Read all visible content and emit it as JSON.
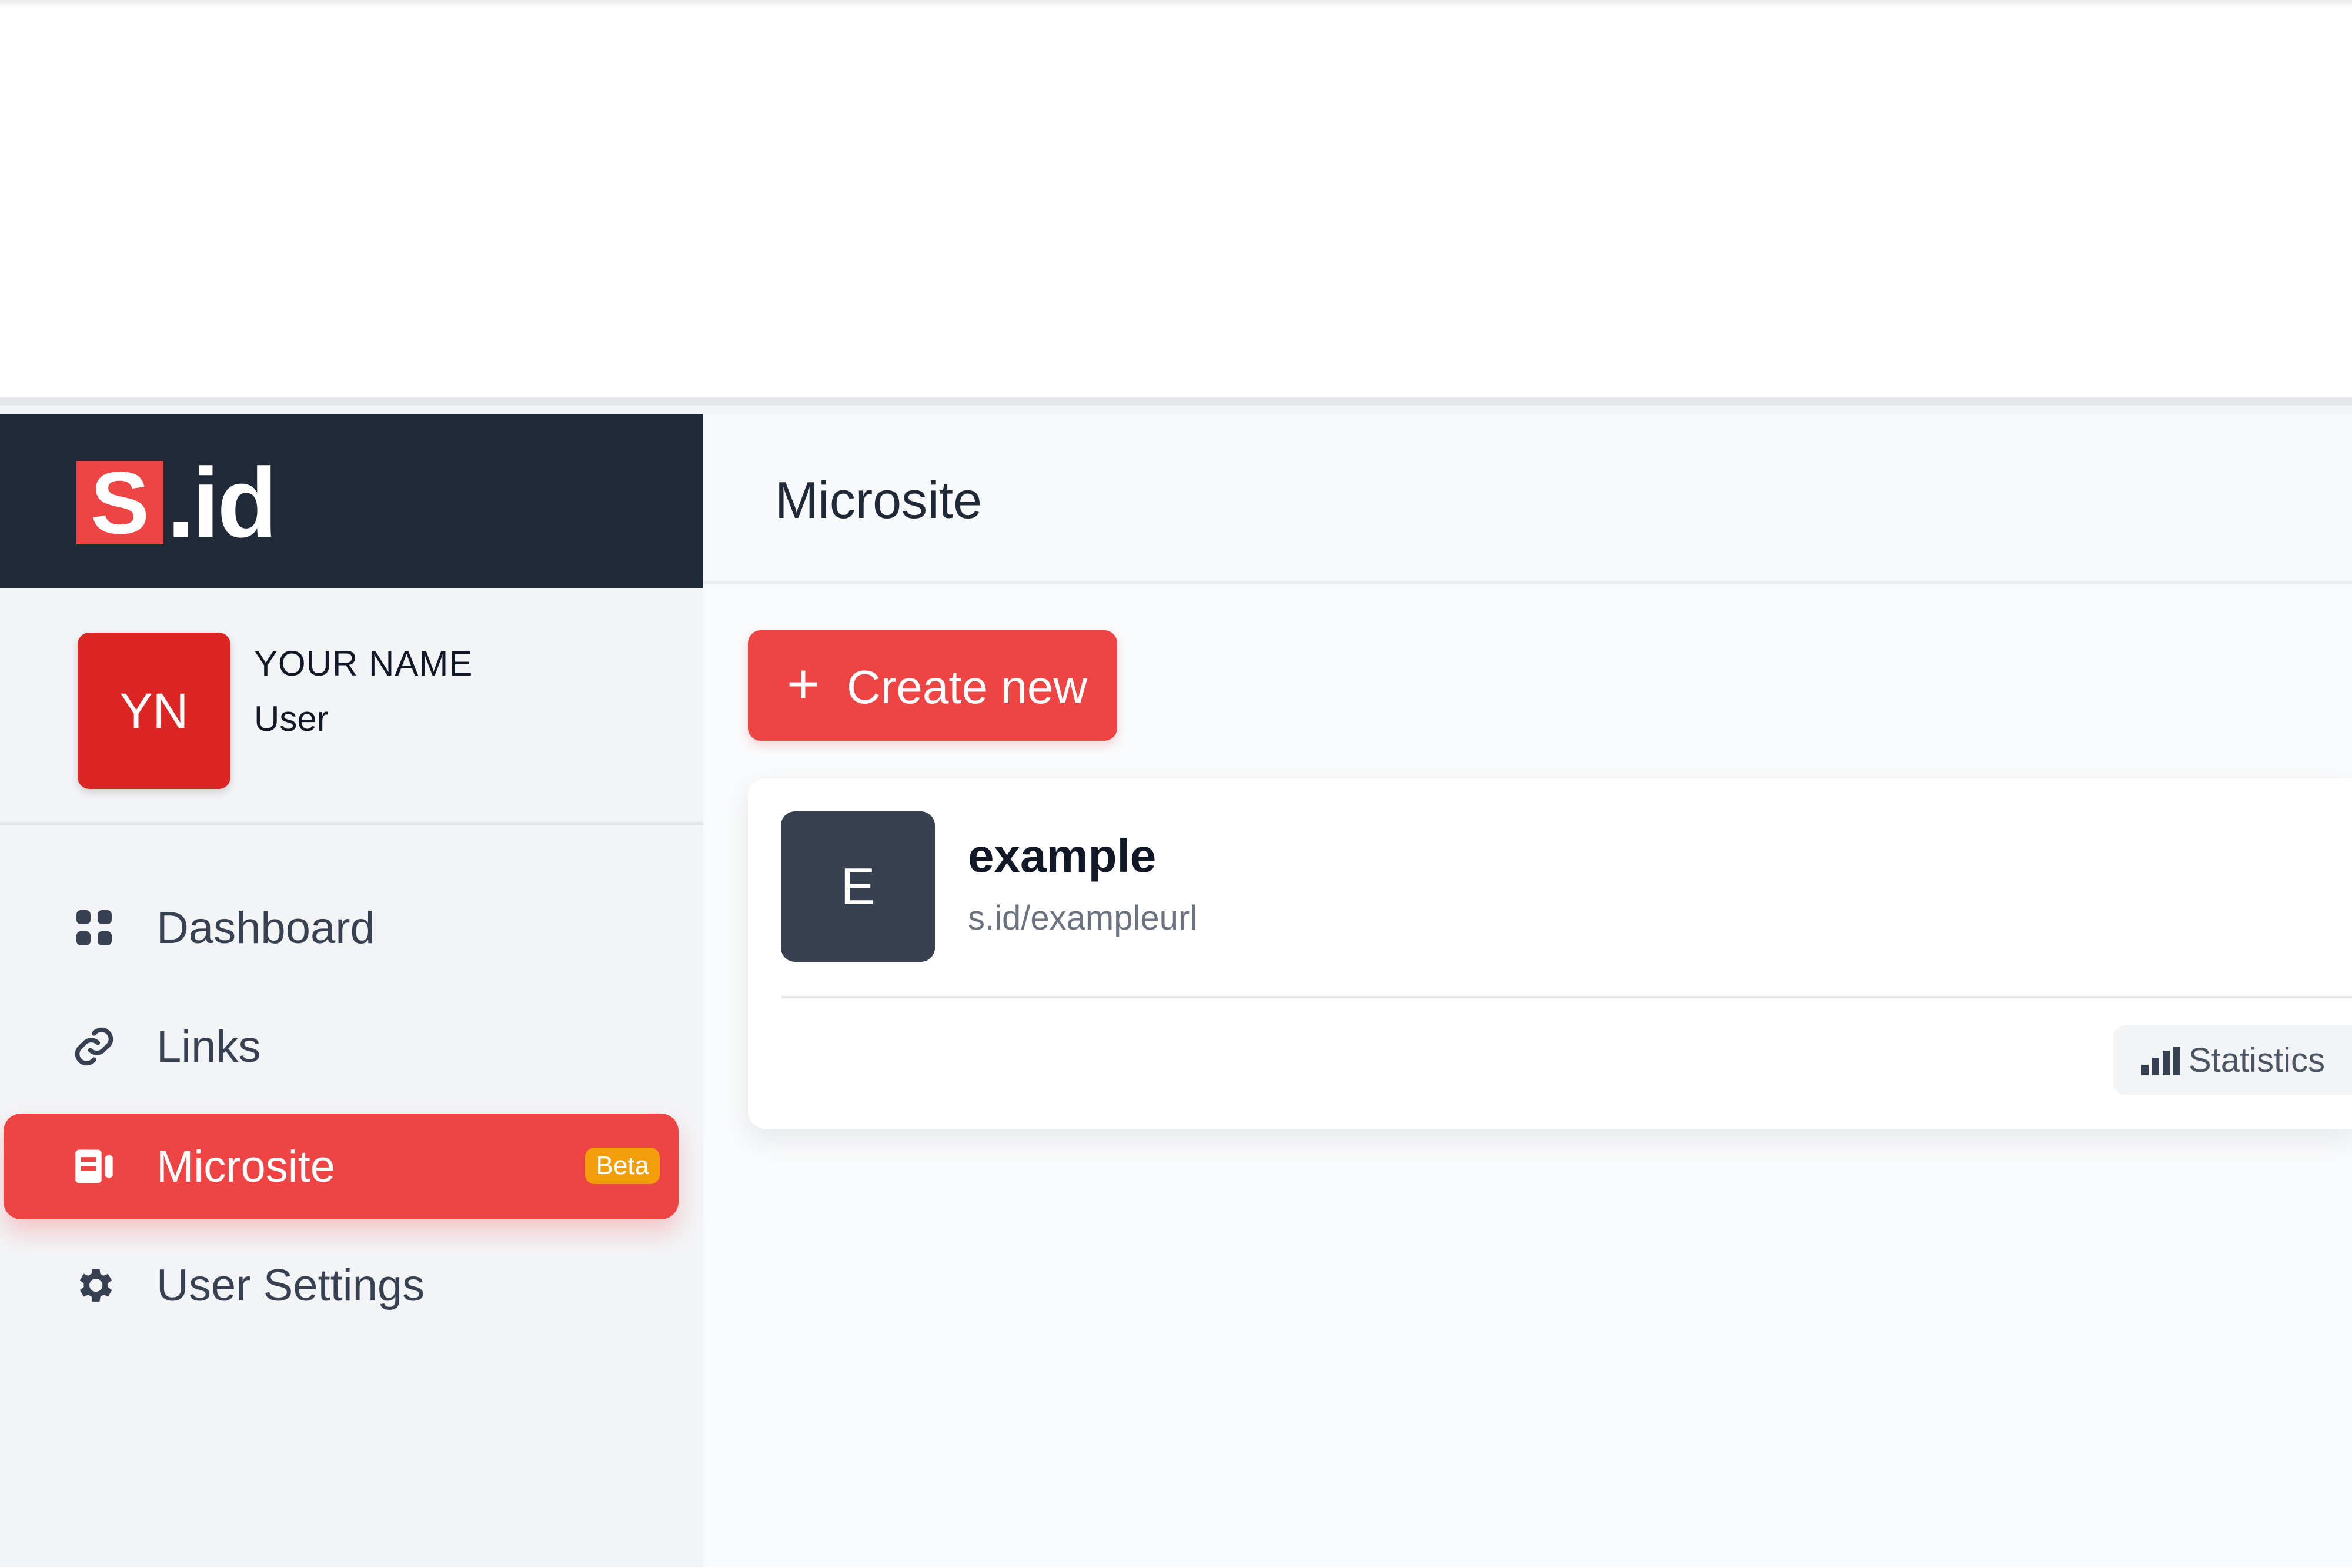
{
  "brand": {
    "logo_mark": "S",
    "logo_text": ".id",
    "logo_color": "#ef4444",
    "header_bg": "#1f2937"
  },
  "profile": {
    "initials": "YN",
    "name": "YOUR NAME",
    "role": "User",
    "avatar_color": "#dc2626"
  },
  "sidebar": {
    "items": [
      {
        "label": "Dashboard",
        "icon": "grid-icon",
        "active": false
      },
      {
        "label": "Links",
        "icon": "link-icon",
        "active": false
      },
      {
        "label": "Microsite",
        "icon": "microsite-icon",
        "active": true,
        "badge": "Beta"
      },
      {
        "label": "User Settings",
        "icon": "gear-icon",
        "active": false
      }
    ],
    "accent": "#ef4444",
    "badge_color": "#f59e0b"
  },
  "main": {
    "title": "Microsite",
    "create_button": {
      "icon": "plus-icon",
      "label": "Create new"
    },
    "sites": [
      {
        "initial": "E",
        "name": "example",
        "url": "s.id/exampleurl",
        "stats_label": "Statistics",
        "stats_icon": "bar-chart-icon"
      }
    ]
  }
}
